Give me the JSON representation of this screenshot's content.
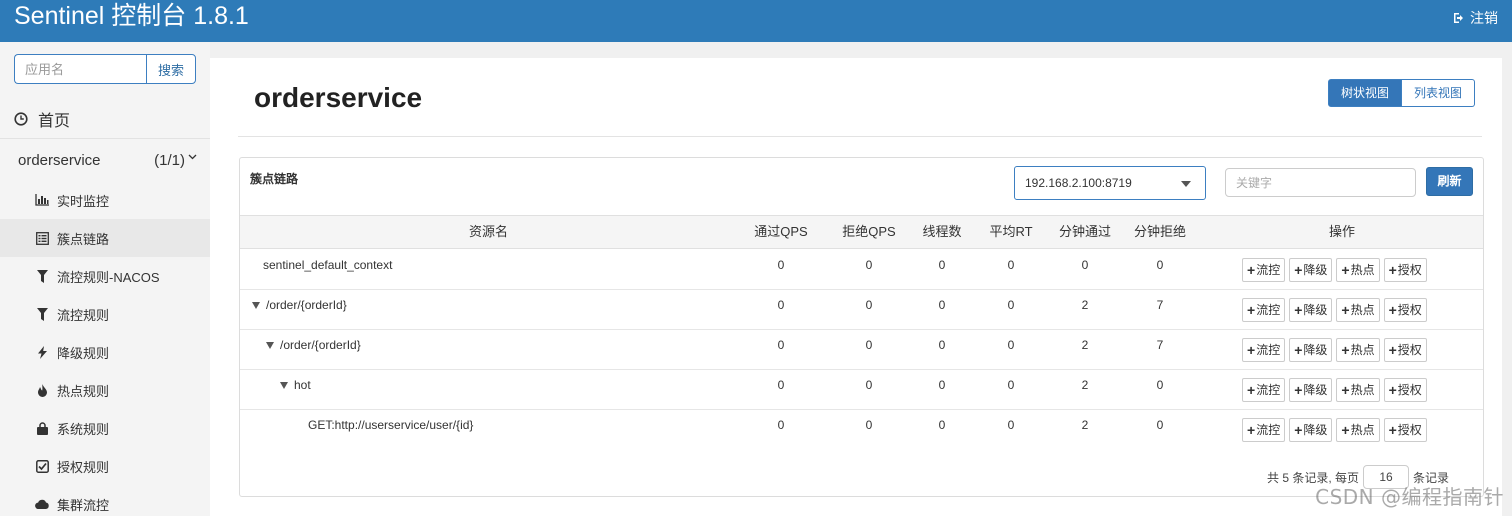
{
  "app": {
    "title": "Sentinel 控制台 1.8.1",
    "logout_label": "注销"
  },
  "sidebar": {
    "search_placeholder": "应用名",
    "search_button": "搜索",
    "home_label": "首页",
    "app_name": "orderservice",
    "app_count": "(1/1)",
    "items": [
      {
        "label": "实时监控",
        "icon": "bar-chart-icon"
      },
      {
        "label": "簇点链路",
        "icon": "list-icon",
        "active": true
      },
      {
        "label": "流控规则-NACOS",
        "icon": "filter-icon"
      },
      {
        "label": "流控规则",
        "icon": "filter-icon"
      },
      {
        "label": "降级规则",
        "icon": "flash-icon"
      },
      {
        "label": "热点规则",
        "icon": "fire-icon"
      },
      {
        "label": "系统规则",
        "icon": "lock-icon"
      },
      {
        "label": "授权规则",
        "icon": "check-square-icon"
      },
      {
        "label": "集群流控",
        "icon": "cloud-icon"
      }
    ]
  },
  "main": {
    "title": "orderservice",
    "view_tree": "树状视图",
    "view_list": "列表视图",
    "panel_title": "簇点链路",
    "machine": "192.168.2.100:8719",
    "keyword_placeholder": "关键字",
    "refresh_label": "刷新",
    "columns": [
      "资源名",
      "通过QPS",
      "拒绝QPS",
      "线程数",
      "平均RT",
      "分钟通过",
      "分钟拒绝",
      "操作"
    ],
    "op_labels": [
      "流控",
      "降级",
      "热点",
      "授权"
    ],
    "rows": [
      {
        "name": "sentinel_default_context",
        "level": 0,
        "expanded": false,
        "pass_qps": "0",
        "block_qps": "0",
        "threads": "0",
        "avg_rt": "0",
        "min_pass": "0",
        "min_block": "0"
      },
      {
        "name": "/order/{orderId}",
        "level": 0,
        "expanded": true,
        "pass_qps": "0",
        "block_qps": "0",
        "threads": "0",
        "avg_rt": "0",
        "min_pass": "2",
        "min_block": "7"
      },
      {
        "name": "/order/{orderId}",
        "level": 1,
        "expanded": true,
        "pass_qps": "0",
        "block_qps": "0",
        "threads": "0",
        "avg_rt": "0",
        "min_pass": "2",
        "min_block": "7"
      },
      {
        "name": "hot",
        "level": 2,
        "expanded": true,
        "pass_qps": "0",
        "block_qps": "0",
        "threads": "0",
        "avg_rt": "0",
        "min_pass": "2",
        "min_block": "0"
      },
      {
        "name": "GET:http://userservice/user/{id}",
        "level": 3,
        "expanded": false,
        "pass_qps": "0",
        "block_qps": "0",
        "threads": "0",
        "avg_rt": "0",
        "min_pass": "2",
        "min_block": "0"
      }
    ],
    "pager_prefix": "共 5 条记录, 每页",
    "page_size": "16",
    "pager_suffix": "条记录",
    "watermark": "CSDN @编程指南针"
  }
}
